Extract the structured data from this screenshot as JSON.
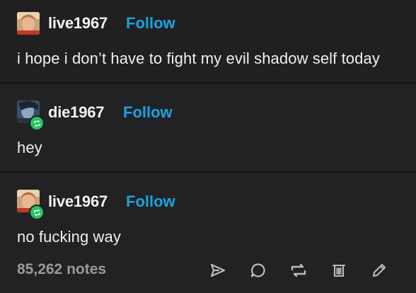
{
  "posts": [
    {
      "username": "live1967",
      "follow_label": "Follow",
      "text": "i hope i don’t have to fight my evil shadow self today",
      "avatar": "portrait-avatar",
      "reblogged": false
    },
    {
      "username": "die1967",
      "follow_label": "Follow",
      "text": "hey",
      "avatar": "dark-portrait-avatar",
      "reblogged": true
    },
    {
      "username": "live1967",
      "follow_label": "Follow",
      "text": "no fucking way",
      "avatar": "portrait-avatar",
      "reblogged": true
    }
  ],
  "footer": {
    "notes_label": "85,262 notes",
    "actions": [
      "send-icon",
      "reply-icon",
      "reblog-icon",
      "delete-icon",
      "edit-icon"
    ]
  },
  "colors": {
    "background": "#1f1f21",
    "follow": "#1aa3e0",
    "reblog_badge": "#22c55e",
    "notes": "#9a9a9c"
  }
}
